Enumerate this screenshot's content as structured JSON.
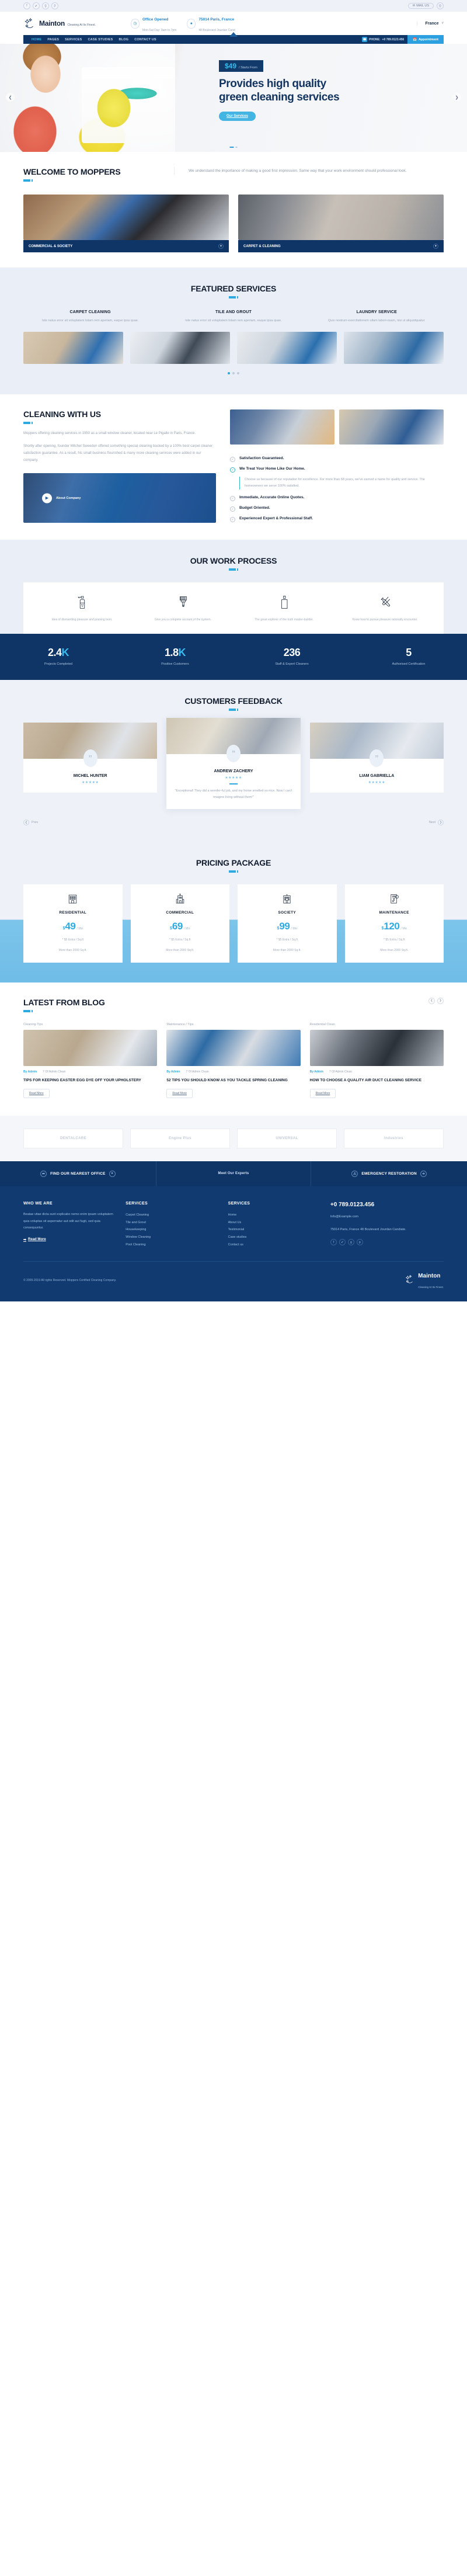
{
  "topbar": {
    "social": [
      {
        "name": "facebook-icon",
        "glyph": "f"
      },
      {
        "name": "twitter-icon",
        "glyph": "✔"
      },
      {
        "name": "google-plus-icon",
        "glyph": "g"
      },
      {
        "name": "pinterest-icon",
        "glyph": "p"
      }
    ],
    "mail_label": "MAIL US",
    "mail_icon": "envelope-icon",
    "search_icon": "search-icon"
  },
  "header": {
    "brand": "Mainton",
    "tagline": "Cleaning At Its Finest.",
    "info": [
      {
        "icon": "clock-icon",
        "title": "Office Opened",
        "sub": "Mon-Sat Day: 9am to 7pm"
      },
      {
        "icon": "location-pin-icon",
        "title": "75014 Paris, France",
        "sub": "48 Boulevard Jourdan Cand"
      }
    ],
    "language": "France",
    "caret": "˅"
  },
  "nav": {
    "items": [
      {
        "label": "HOME",
        "active": true
      },
      {
        "label": "PAGES",
        "active": false
      },
      {
        "label": "SERVICES",
        "active": false
      },
      {
        "label": "CASE STUDIES",
        "active": false
      },
      {
        "label": "BLOG",
        "active": false
      },
      {
        "label": "CONTACT US",
        "active": false
      }
    ],
    "phone_label": "PHONE:",
    "phone": "+0 789.0123.456",
    "appointment": "Appointment",
    "appointment_icon": "calendar-icon"
  },
  "hero": {
    "price": "$49",
    "price_sub": "/ Starts From",
    "heading": "Provides high quality green cleaning services",
    "button": "Our Services",
    "prev_icon": "chevron-left-icon",
    "next_icon": "chevron-right-icon"
  },
  "welcome": {
    "title": "WELCOME TO MOPPERS",
    "lead": "We understand the importance of making a good first impression. Same way that your work environment should professional look.",
    "cards": [
      {
        "label": "COMMERCIAL & SOCIETY",
        "plus": "+"
      },
      {
        "label": "CARPET & CLEANING",
        "plus": "+"
      }
    ]
  },
  "featured": {
    "title": "FEATURED SERVICES",
    "cols": [
      {
        "name": "CARPET CLEANING",
        "text": "Iste natus error sit voluptatem totam rem aperiam, eaque ipsa quae."
      },
      {
        "name": "TILE AND GROUT",
        "text": "Iste natus error sit voluptatem totam rem aperiam, eaque ipsa quae."
      },
      {
        "name": "LAUNDRY SERVICE",
        "text": "Quis nostrum exercitationem ullam labori-osam, nisi ut aliquidquatur."
      }
    ],
    "dots": [
      true,
      false,
      false
    ]
  },
  "cleaning": {
    "title": "CLEANING WITH US",
    "p1": "Moppers offering cleaning services in 1950 as a small window cleaner, located near Le Pigalle in Paris, France.",
    "p2": "Shortly after opening, founder Mitchel Sweedon offered something special cleaning backed by a 100% best carpet cleaner satisfaction guarantee. As a result, his small business flourished & many more cleaning services were added in our company.",
    "video_label": "About Company",
    "play_icon": "play-icon",
    "features": [
      {
        "title": "Satisfaction Guaranteed.",
        "active": false,
        "desc": null
      },
      {
        "title": "We Treat Your Home Like Our Home.",
        "active": true,
        "desc": "Choose us because of our reputation for excellence. For more than 68 years, we've earned a name for quality and service. The homeowners we serve 100% satisfied."
      },
      {
        "title": "Immediate, Accurate Online Quotes.",
        "active": false,
        "desc": null
      },
      {
        "title": "Budget Oriented.",
        "active": false,
        "desc": null
      },
      {
        "title": "Experienced Expert & Professional Staff.",
        "active": false,
        "desc": null
      }
    ]
  },
  "process": {
    "title": "OUR WORK PROCESS",
    "steps": [
      {
        "icon": "spray-bottle-icon",
        "text": "Idea of dismantling pleasure and praising born."
      },
      {
        "icon": "paint-brush-icon",
        "text": "Give you a complete account of the system."
      },
      {
        "icon": "detergent-bottle-icon",
        "text": "The great explorer of the truth master-builder."
      },
      {
        "icon": "tools-icon",
        "text": "Know how to pursue pleasure rationally encounter."
      }
    ],
    "counters": [
      {
        "value": "2.4",
        "suffix": "K",
        "label": "Projects Completed"
      },
      {
        "value": "1.8",
        "suffix": "K",
        "label": "Positive Customers"
      },
      {
        "value": "236",
        "suffix": "",
        "label": "Staff & Expert Cleaners"
      },
      {
        "value": "5",
        "suffix": "",
        "label": "Authorised Certification"
      }
    ]
  },
  "feedback": {
    "title": "CUSTOMERS FEEDBACK",
    "cards": [
      {
        "name": "MICHEL HUNTER",
        "stars": "★★★★★",
        "text": null
      },
      {
        "name": "ANDREW ZACHERY",
        "stars": "★★★★★",
        "text": "\"Exceptional! They did a wonder-ful job, and my home smelled so nice. Now I can't imagine living without them!\""
      },
      {
        "name": "LIAM GABRIELLA",
        "stars": "★★★★★",
        "text": null
      }
    ],
    "prev": "Prev",
    "next": "Next",
    "prev_icon": "chevron-left-icon",
    "next_icon": "chevron-right-icon"
  },
  "pricing": {
    "title": "PRICING PACKAGE",
    "plans": [
      {
        "icon": "apartment-building-icon",
        "name": "RESIDENTIAL",
        "currency": "$",
        "amount": "49",
        "per": "/ Mo",
        "l1": "* $5 Extra / Sq.ft",
        "l2": "More than 2000 Sq.ft."
      },
      {
        "icon": "office-building-icon",
        "name": "COMMERCIAL",
        "currency": "$",
        "amount": "69",
        "per": "/ Mo",
        "l1": "* $5 Extra / Sq.ft",
        "l2": "More than 2000 Sq.ft."
      },
      {
        "icon": "hospital-building-icon",
        "name": "SOCIETY",
        "currency": "$",
        "amount": "99",
        "per": "/ Mo",
        "l1": "* $5 Extra / Sq.ft",
        "l2": "More than 2000 Sq.ft."
      },
      {
        "icon": "maintenance-document-icon",
        "name": "MAINTENANCE",
        "currency": "$",
        "amount": "120",
        "per": "/ Mo",
        "l1": "* $5 Extra / Sq.ft",
        "l2": "More than 2000 Sq.ft."
      }
    ]
  },
  "blog": {
    "title": "LATEST FROM BLOG",
    "prev_icon": "chevron-left-icon",
    "next_icon": "chevron-right-icon",
    "posts": [
      {
        "category": "Cleaning Tips",
        "author": "By Admin",
        "comments": "7 Of Admin Clean",
        "title": "TIPS FOR KEEPING EASTER EGG DYE OFF YOUR UPHOLSTERY",
        "button": "Read More"
      },
      {
        "category": "Maintenance / Tips",
        "author": "By Admin",
        "comments": "7 Of Admin Clean",
        "title": "52 TIPS YOU SHOULD KNOW AS YOU TACKLE SPRING CLEANING",
        "button": "Read More"
      },
      {
        "category": "Residential Clean",
        "author": "By Admin",
        "comments": "7 Of Admin Clean",
        "title": "HOW TO CHOOSE A QUALITY AIR DUCT CLEANING SERVICE",
        "button": "Read More"
      }
    ]
  },
  "clients": [
    {
      "name": "DENTALCARE"
    },
    {
      "name": "Engine Plus"
    },
    {
      "name": "UNIVERSAL"
    },
    {
      "name": "Industries"
    }
  ],
  "cta": {
    "left": "FIND OUR NEAREST OFFICE",
    "left_icon": "compass-icon",
    "left_icon2": "pin-icon",
    "mid": "Meet Our Experts",
    "right": "EMERGENCY RESTORATION",
    "right_icon": "alert-icon",
    "right_icon2": "arrow-icon"
  },
  "footer": {
    "cols": [
      {
        "heading": "WHO WE ARE",
        "text": "Beatae vitae dicta sunt explicabo nemo enim ipsam voluptatem quia voluptas sit aspernatur aut odit aut fugit, sed quia consequuntur.",
        "readmore": "Read More"
      },
      {
        "heading": "SERVICES",
        "items": [
          "Carpet Cleaning",
          "Tile and Grout",
          "Housekeeping",
          "Window Cleaning",
          "Pool Cleaning"
        ]
      },
      {
        "heading": "SERVICES",
        "items": [
          "Home",
          "About Us",
          "Testimonial",
          "Case studies",
          "Contact us"
        ]
      }
    ],
    "contact": {
      "phone": "+0 789.0123.456",
      "email": "Info@Example.com",
      "address": "75014 Paris, France 48 Boulevard Jourdan Candiate.",
      "social": [
        {
          "name": "facebook-icon",
          "glyph": "f"
        },
        {
          "name": "twitter-icon",
          "glyph": "✔"
        },
        {
          "name": "google-plus-icon",
          "glyph": "g"
        },
        {
          "name": "pinterest-icon",
          "glyph": "p"
        }
      ]
    },
    "copyright": "© 2009-2019 All rights Reserved. Moppers Certified Cleaning Company.",
    "brand": "Mainton",
    "brand_tag": "Cleaning At Its Finest."
  }
}
